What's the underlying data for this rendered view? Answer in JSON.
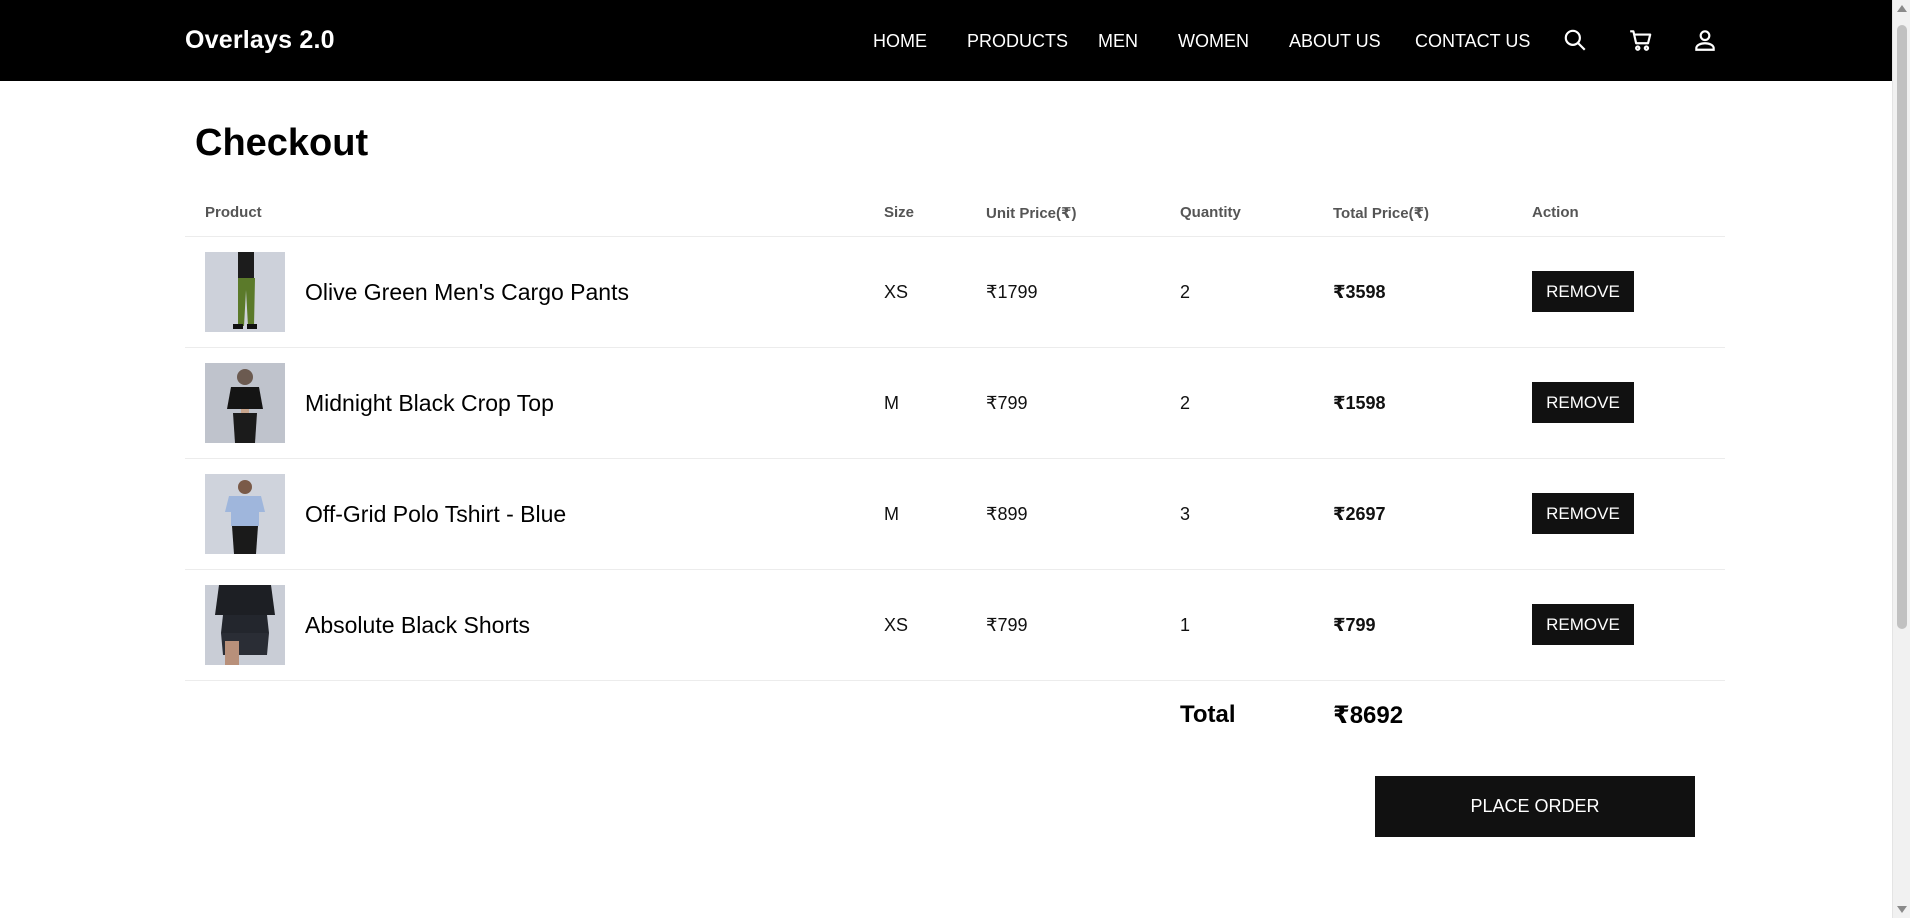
{
  "navbar": {
    "brand": "Overlays 2.0",
    "links": [
      "HOME",
      "PRODUCTS",
      "MEN",
      "WOMEN",
      "ABOUT US",
      "CONTACT US"
    ],
    "icons": [
      "search-icon",
      "cart-icon",
      "user-icon"
    ]
  },
  "page": {
    "title": "Checkout"
  },
  "table": {
    "headers": {
      "product": "Product",
      "size": "Size",
      "unit_price": "Unit Price(₹)",
      "quantity": "Quantity",
      "total_price": "Total Price(₹)",
      "action": "Action"
    },
    "rows": [
      {
        "name": "Olive Green Men's Cargo Pants",
        "size": "XS",
        "unit_price": "₹1799",
        "quantity": "2",
        "total_price": "₹3598",
        "action": "REMOVE"
      },
      {
        "name": "Midnight Black Crop Top",
        "size": "M",
        "unit_price": "₹799",
        "quantity": "2",
        "total_price": "₹1598",
        "action": "REMOVE"
      },
      {
        "name": "Off-Grid Polo Tshirt - Blue",
        "size": "M",
        "unit_price": "₹899",
        "quantity": "3",
        "total_price": "₹2697",
        "action": "REMOVE"
      },
      {
        "name": "Absolute Black Shorts",
        "size": "XS",
        "unit_price": "₹799",
        "quantity": "1",
        "total_price": "₹799",
        "action": "REMOVE"
      }
    ]
  },
  "summary": {
    "total_label": "Total",
    "total_value": "₹8692"
  },
  "place_order_label": "PLACE ORDER",
  "colors": {
    "navbar_bg": "#000000",
    "button_bg": "#111111",
    "button_text": "#ffffff"
  }
}
